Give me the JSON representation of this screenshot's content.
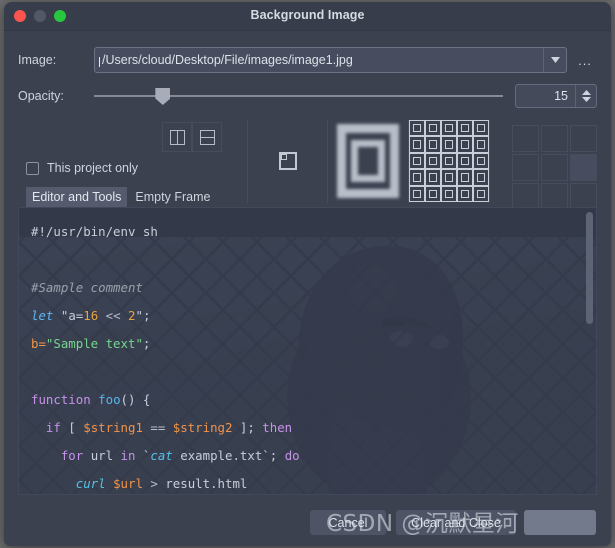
{
  "window": {
    "title": "Background Image",
    "traffic_lights": [
      "close",
      "minimize",
      "zoom"
    ]
  },
  "image_row": {
    "label": "Image:",
    "path_value": "/Users/cloud/Desktop/File/images/image1.jpg",
    "dropdown_icon": "chevron-down-icon",
    "browse_label": "..."
  },
  "opacity_row": {
    "label": "Opacity:",
    "value": "15",
    "slider_percent": 15,
    "min": 0,
    "max": 100
  },
  "options": {
    "view_buttons": [
      {
        "name": "split-vertical-icon"
      },
      {
        "name": "split-horizontal-icon"
      }
    ],
    "checkbox": {
      "label": "This project only",
      "checked": false
    },
    "tabs": [
      {
        "label": "Editor and Tools",
        "selected": true
      },
      {
        "label": "Empty Frame",
        "selected": false
      }
    ],
    "fill_modes": [
      {
        "name": "original-size"
      },
      {
        "name": "scaled-blurred"
      },
      {
        "name": "tiled"
      }
    ],
    "anchor_grid": {
      "rows": 3,
      "cols": 3,
      "hovered_index": 5
    }
  },
  "editor": {
    "lines": [
      [
        {
          "t": "#!/usr/bin/env sh",
          "c": "k-plain"
        }
      ],
      [],
      [
        {
          "t": "#Sample comment",
          "c": "k-cmt"
        }
      ],
      [
        {
          "t": "let",
          "c": "k-def"
        },
        {
          "t": " ",
          "c": "k-plain"
        },
        {
          "t": "\"a=",
          "c": "k-plain"
        },
        {
          "t": "16",
          "c": "k-num"
        },
        {
          "t": " << ",
          "c": "k-op"
        },
        {
          "t": "2",
          "c": "k-num"
        },
        {
          "t": "\";",
          "c": "k-plain"
        }
      ],
      [
        {
          "t": "b=",
          "c": "k-var"
        },
        {
          "t": "\"Sample text\"",
          "c": "k-str"
        },
        {
          "t": ";",
          "c": "k-plain"
        }
      ],
      [],
      [
        {
          "t": "function",
          "c": "k-kw"
        },
        {
          "t": " ",
          "c": "k-plain"
        },
        {
          "t": "foo",
          "c": "k-fn"
        },
        {
          "t": "() {",
          "c": "k-plain"
        }
      ],
      [
        {
          "t": "  ",
          "c": "k-plain"
        },
        {
          "t": "if",
          "c": "k-kw"
        },
        {
          "t": " [ ",
          "c": "k-plain"
        },
        {
          "t": "$string1",
          "c": "k-var"
        },
        {
          "t": " == ",
          "c": "k-op"
        },
        {
          "t": "$string2",
          "c": "k-var"
        },
        {
          "t": " ]; ",
          "c": "k-plain"
        },
        {
          "t": "then",
          "c": "k-kw"
        }
      ],
      [
        {
          "t": "    ",
          "c": "k-plain"
        },
        {
          "t": "for",
          "c": "k-kw"
        },
        {
          "t": " url ",
          "c": "k-plain"
        },
        {
          "t": "in",
          "c": "k-kw"
        },
        {
          "t": " `",
          "c": "k-plain"
        },
        {
          "t": "cat",
          "c": "k-cmd"
        },
        {
          "t": " example.txt`; ",
          "c": "k-plain"
        },
        {
          "t": "do",
          "c": "k-kw"
        }
      ],
      [
        {
          "t": "      ",
          "c": "k-plain"
        },
        {
          "t": "curl",
          "c": "k-cmd"
        },
        {
          "t": " ",
          "c": "k-plain"
        },
        {
          "t": "$url",
          "c": "k-var"
        },
        {
          "t": " > ",
          "c": "k-op"
        },
        {
          "t": "result.html",
          "c": "k-plain"
        }
      ]
    ],
    "scrollbar": {
      "thumb_top_percent": 0,
      "thumb_height_percent": 40
    }
  },
  "footer": {
    "cancel_label": "Cancel",
    "clear_label": "Clear and Close",
    "ok_label": ""
  },
  "watermark": {
    "text": "CSDN @沉默星河"
  },
  "colors": {
    "dialog_bg": "#3c4150",
    "titlebar_bg": "#383d4b",
    "field_bg": "#474d5e",
    "accent_close": "#f9554e",
    "accent_zoom": "#28c63f",
    "text": "#cfd4de"
  }
}
